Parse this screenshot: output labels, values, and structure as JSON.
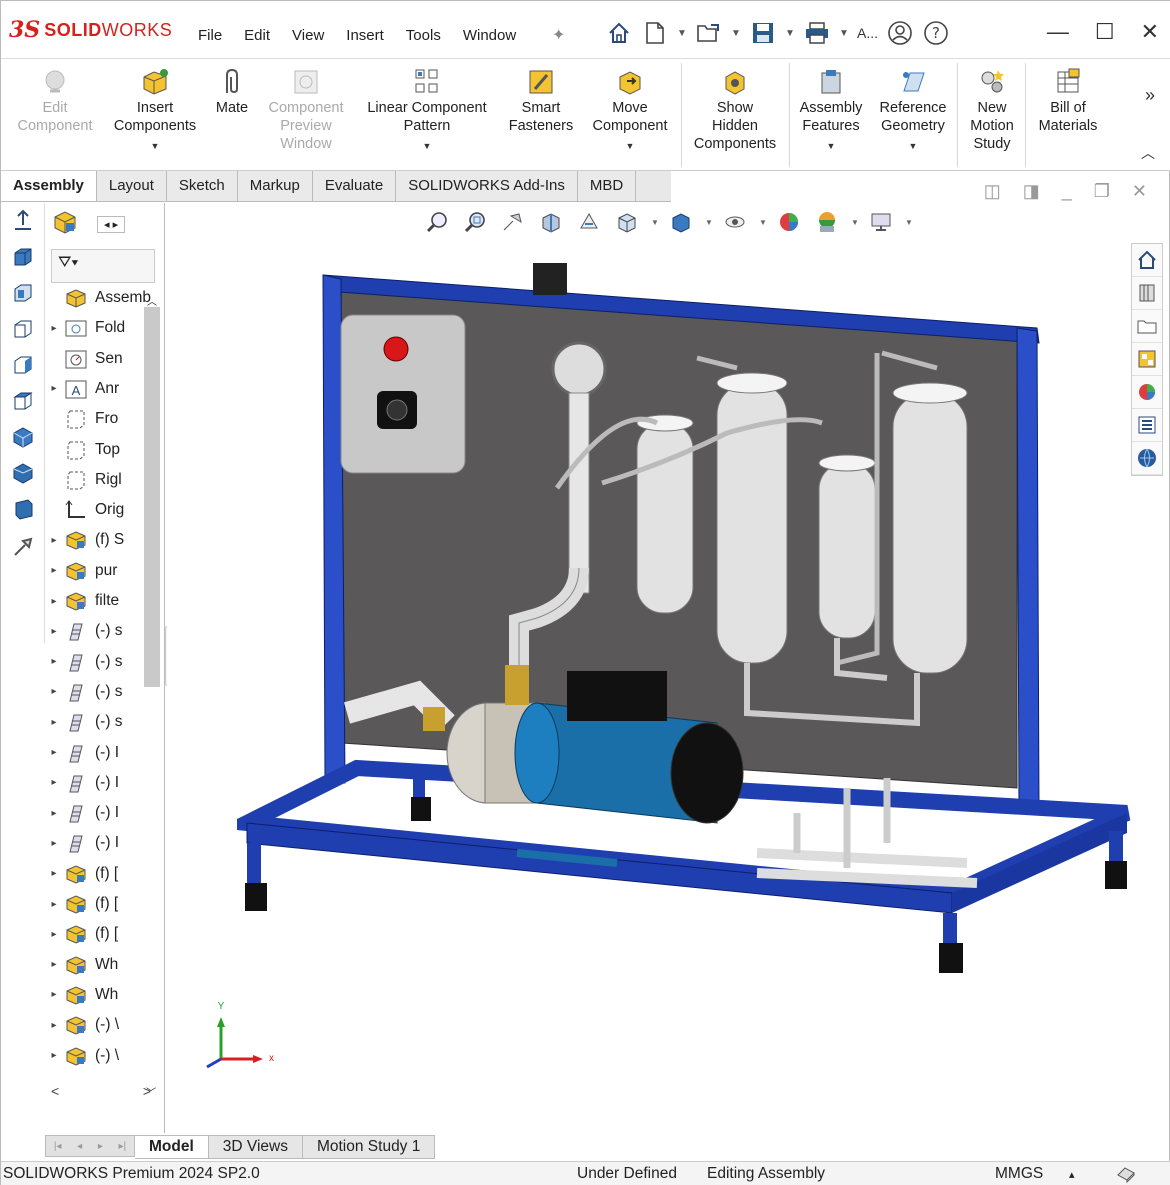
{
  "app": {
    "logo_ds": "3S",
    "logo_solid": "SOLID",
    "logo_works": "WORKS",
    "menu": [
      "File",
      "Edit",
      "View",
      "Insert",
      "Tools",
      "Window"
    ],
    "user_abbrev": "A..."
  },
  "ribbon": {
    "edit_component": [
      "Edit",
      "Component"
    ],
    "insert_components": [
      "Insert",
      "Components"
    ],
    "mate": [
      "Mate"
    ],
    "component_preview": [
      "Component",
      "Preview",
      "Window"
    ],
    "linear_pattern": [
      "Linear Component",
      "Pattern"
    ],
    "smart_fasteners": [
      "Smart",
      "Fasteners"
    ],
    "move_component": [
      "Move",
      "Component"
    ],
    "show_hidden": [
      "Show",
      "Hidden",
      "Components"
    ],
    "assembly_features": [
      "Assembly",
      "Features"
    ],
    "reference_geometry": [
      "Reference",
      "Geometry"
    ],
    "new_motion_study": [
      "New",
      "Motion",
      "Study"
    ],
    "bill_of_materials": [
      "Bill of",
      "Materials"
    ]
  },
  "tabs": [
    "Assembly",
    "Layout",
    "Sketch",
    "Markup",
    "Evaluate",
    "SOLIDWORKS Add-Ins",
    "MBD"
  ],
  "tree": {
    "items": [
      {
        "label": "Assemb",
        "expander": "",
        "icon": "assembly-icon"
      },
      {
        "label": "Fold",
        "expander": "▸",
        "icon": "folder-icon"
      },
      {
        "label": "Sen",
        "expander": "",
        "icon": "sensor-icon"
      },
      {
        "label": "Anr",
        "expander": "▸",
        "icon": "annotation-icon"
      },
      {
        "label": "Fro",
        "expander": "",
        "icon": "plane-icon"
      },
      {
        "label": "Top",
        "expander": "",
        "icon": "plane-icon"
      },
      {
        "label": "Rigl",
        "expander": "",
        "icon": "plane-icon"
      },
      {
        "label": "Orig",
        "expander": "",
        "icon": "origin-icon"
      },
      {
        "label": "(f) S",
        "expander": "▸",
        "icon": "subassembly-icon"
      },
      {
        "label": "pur",
        "expander": "▸",
        "icon": "subassembly-icon"
      },
      {
        "label": "filte",
        "expander": "▸",
        "icon": "subassembly-icon"
      },
      {
        "label": "(-) s",
        "expander": "▸",
        "icon": "part-icon"
      },
      {
        "label": "(-) s",
        "expander": "▸",
        "icon": "part-icon"
      },
      {
        "label": "(-) s",
        "expander": "▸",
        "icon": "part-icon"
      },
      {
        "label": "(-) s",
        "expander": "▸",
        "icon": "part-icon"
      },
      {
        "label": "(-) I",
        "expander": "▸",
        "icon": "part-icon"
      },
      {
        "label": "(-) I",
        "expander": "▸",
        "icon": "part-icon"
      },
      {
        "label": "(-) I",
        "expander": "▸",
        "icon": "part-icon"
      },
      {
        "label": "(-) I",
        "expander": "▸",
        "icon": "part-icon"
      },
      {
        "label": "(f) [",
        "expander": "▸",
        "icon": "subassembly-icon"
      },
      {
        "label": "(f) [",
        "expander": "▸",
        "icon": "subassembly-icon"
      },
      {
        "label": "(f) [",
        "expander": "▸",
        "icon": "subassembly-icon"
      },
      {
        "label": "Wh",
        "expander": "▸",
        "icon": "subassembly-icon"
      },
      {
        "label": "Wh",
        "expander": "▸",
        "icon": "subassembly-icon"
      },
      {
        "label": "(-) \\",
        "expander": "▸",
        "icon": "subassembly-icon"
      },
      {
        "label": "(-) \\",
        "expander": "▸",
        "icon": "subassembly-icon"
      }
    ]
  },
  "triad": {
    "x": "x",
    "y": "Y"
  },
  "bottom_tabs": [
    "Model",
    "3D Views",
    "Motion Study 1"
  ],
  "status": {
    "product": "SOLIDWORKS Premium 2024 SP2.0",
    "state": "Under Defined",
    "mode": "Editing Assembly",
    "units": "MMGS",
    "units_arrow": "▴"
  },
  "colors": {
    "brand": "#d6201c",
    "frame": "#1f3fb0",
    "panel": "#5a5858",
    "motor": "#1b6fa8"
  }
}
